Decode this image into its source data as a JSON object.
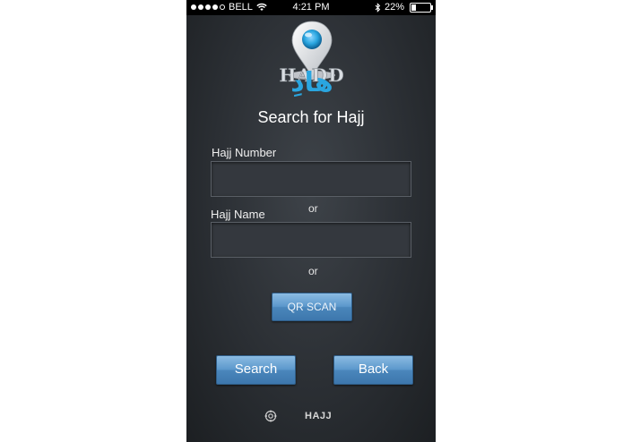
{
  "status_bar": {
    "carrier": "BELL",
    "time": "4:21 PM",
    "battery_percent": "22%",
    "battery_level": 0.22,
    "signal_bars_filled": 4,
    "signal_bars_total": 5
  },
  "logo": {
    "wordmark": "HADD",
    "arabic": "هادِ",
    "icon": "map-pin-icon",
    "accent_color": "#2aa6e0"
  },
  "page": {
    "title": "Search for Hajj"
  },
  "form": {
    "hajj_number_label": "Hajj Number",
    "hajj_number_value": "",
    "or_1": "or",
    "hajj_name_label": "Hajj Name",
    "hajj_name_value": "",
    "or_2": "or",
    "qr_scan_label": "QR SCAN"
  },
  "actions": {
    "search_label": "Search",
    "back_label": "Back"
  },
  "footer": {
    "icon": "target-icon",
    "text": "HAJJ"
  },
  "colors": {
    "button_blue": "#5c98cc",
    "background": "#2b2f34"
  }
}
